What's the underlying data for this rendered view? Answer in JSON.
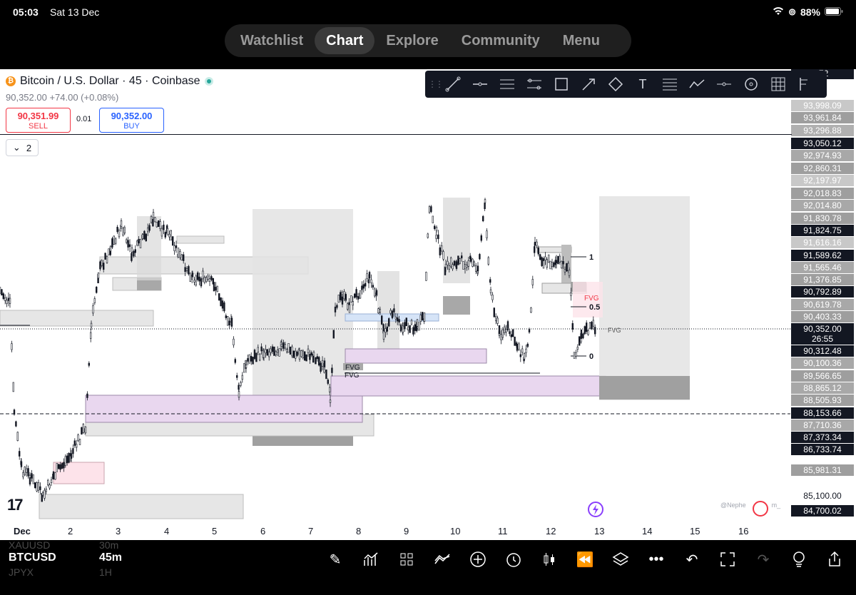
{
  "status_bar": {
    "time": "05:03",
    "date": "Sat 13 Dec",
    "battery": "88%"
  },
  "nav": {
    "tabs": [
      {
        "label": "Watchlist",
        "active": false
      },
      {
        "label": "Chart",
        "active": true
      },
      {
        "label": "Explore",
        "active": false
      },
      {
        "label": "Community",
        "active": false
      },
      {
        "label": "Menu",
        "active": false
      }
    ]
  },
  "symbol_header": {
    "title": "Bitcoin / U.S. Dollar · 45 · Coinbase",
    "price_change": "90,352.00 +74.00 (+0.08%)",
    "sell_price": "90,351.99",
    "sell_label": "SELL",
    "spread": "0.01",
    "buy_price": "90,352.00",
    "buy_label": "BUY",
    "indicator_count": "2"
  },
  "drawing_tools": [
    "trend-line",
    "horizontal-line",
    "parallel-channel",
    "regression",
    "rectangle",
    "arrow",
    "polygon",
    "text",
    "fib",
    "path",
    "ray",
    "circle",
    "table",
    "pitchfork"
  ],
  "price_scale": {
    "labels": [
      {
        "text": ".72",
        "bg": "#131722"
      },
      {
        "text": "93,998.09",
        "bg": "#c8c8c8"
      },
      {
        "text": "93,961.84",
        "bg": "#9e9e9e"
      },
      {
        "text": "93,296.88",
        "bg": "#b0b0b0"
      },
      {
        "text": "93,050.12",
        "bg": "#131722"
      },
      {
        "text": "92,974.93",
        "bg": "#a8a8a8"
      },
      {
        "text": "92,860.31",
        "bg": "#9e9e9e"
      },
      {
        "text": "92,197.97",
        "bg": "#c8c8c8"
      },
      {
        "text": "92,018.83",
        "bg": "#9e9e9e"
      },
      {
        "text": "92,014.80",
        "bg": "#a8a8a8"
      },
      {
        "text": "91,830.78",
        "bg": "#9e9e9e"
      },
      {
        "text": "91,824.75",
        "bg": "#131722"
      },
      {
        "text": "91,616.16",
        "bg": "#c8c8c8"
      },
      {
        "text": "91,589.62",
        "bg": "#131722"
      },
      {
        "text": "91,565.46",
        "bg": "#a8a8a8"
      },
      {
        "text": "91,376.85",
        "bg": "#9e9e9e"
      },
      {
        "text": "90,792.89",
        "bg": "#131722"
      },
      {
        "text": "90,619.78",
        "bg": "#a8a8a8"
      },
      {
        "text": "90,403.33",
        "bg": "#9e9e9e"
      },
      {
        "text": "90,352.00",
        "bg": "#131722"
      },
      {
        "text": "26:55",
        "bg": "#131722"
      },
      {
        "text": "90,312.48",
        "bg": "#131722"
      },
      {
        "text": "90,100.36",
        "bg": "#a8a8a8"
      },
      {
        "text": "89,566.65",
        "bg": "#9e9e9e"
      },
      {
        "text": "88,865.12",
        "bg": "#a8a8a8"
      },
      {
        "text": "88,505.93",
        "bg": "#9e9e9e"
      },
      {
        "text": "88,153.66",
        "bg": "#131722"
      },
      {
        "text": "87,710.36",
        "bg": "#a8a8a8"
      },
      {
        "text": "87,373.34",
        "bg": "#131722"
      },
      {
        "text": "86,733.74",
        "bg": "#131722"
      },
      {
        "text": "85,981.31",
        "bg": "#9e9e9e"
      },
      {
        "text": "85,100.00",
        "bg": "#ffffff"
      },
      {
        "text": "84,700.02",
        "bg": "#131722"
      }
    ]
  },
  "time_axis": [
    "Dec",
    "2",
    "3",
    "4",
    "5",
    "6",
    "7",
    "8",
    "9",
    "10",
    "11",
    "12",
    "13",
    "14",
    "15",
    "16"
  ],
  "chart_annotations": {
    "fvg_labels": [
      "FVG",
      "FVG",
      "FVG",
      "FVG"
    ],
    "fib_levels": [
      "1",
      "0.5",
      "0"
    ]
  },
  "watermark": "@Nephe",
  "watermark_tail": "m_",
  "bottom_bar": {
    "symbol": "BTCUSD",
    "timeframe": "45m",
    "ghost_symbols": [
      "XAUUSD",
      "JPYX"
    ],
    "ghost_timeframes": [
      "30m",
      "1H"
    ]
  },
  "colors": {
    "background": "#ffffff",
    "candle": "#131722",
    "zone_gray": "#d9d9d9",
    "zone_purple": "#e9d7ef",
    "zone_pink": "#fde3ea",
    "zone_blue": "#d6e4f7"
  }
}
